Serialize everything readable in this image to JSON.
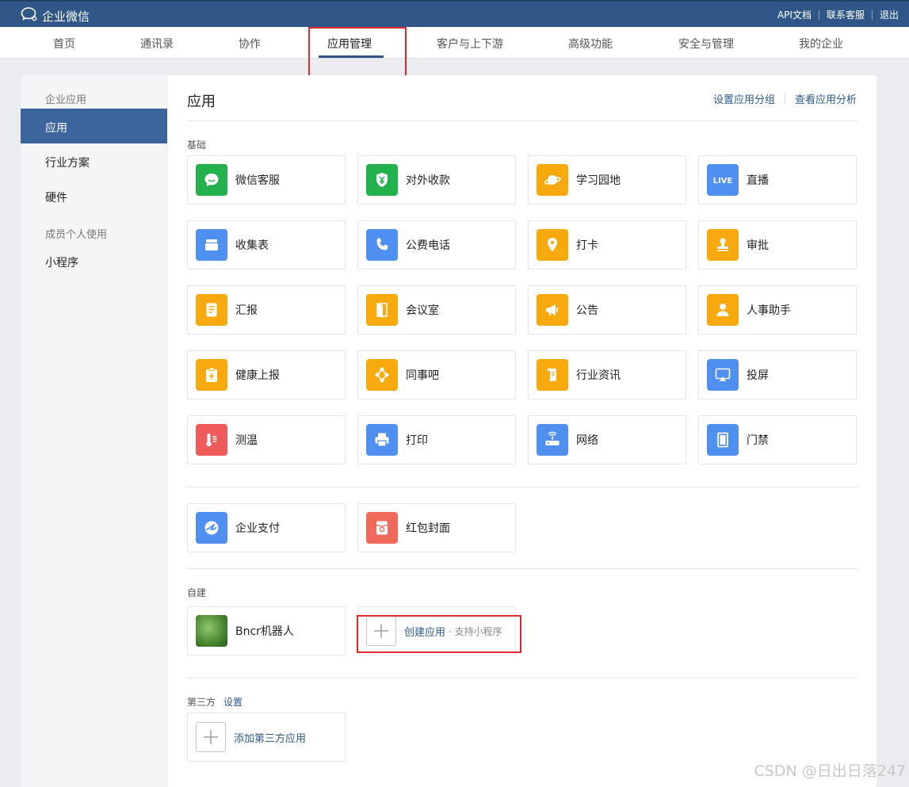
{
  "topbar": {
    "logo_text": "企业微信",
    "links": [
      "API文档",
      "联系客服",
      "退出"
    ]
  },
  "nav": {
    "items": [
      "首页",
      "通讯录",
      "协作",
      "应用管理",
      "客户与上下游",
      "高级功能",
      "安全与管理",
      "我的企业"
    ],
    "active": "应用管理"
  },
  "sidebar": {
    "group1": "企业应用",
    "items1": [
      "应用",
      "行业方案",
      "硬件"
    ],
    "group2": "成员个人使用",
    "items2": [
      "小程序"
    ]
  },
  "main": {
    "title": "应用",
    "actions": [
      "设置应用分组",
      "查看应用分析"
    ],
    "basic_label": "基础",
    "basic_apps": [
      {
        "label": "微信客服",
        "icon": "chat-bubble-icon",
        "color": "#22b14c"
      },
      {
        "label": "对外收款",
        "icon": "yuan-shield-icon",
        "color": "#22b14c"
      },
      {
        "label": "学习园地",
        "icon": "planet-icon",
        "color": "#f7a90e"
      },
      {
        "label": "直播",
        "icon": "live-icon",
        "color": "#4f8fef"
      },
      {
        "label": "收集表",
        "icon": "form-box-icon",
        "color": "#4f8fef"
      },
      {
        "label": "公费电话",
        "icon": "phone-icon",
        "color": "#4f8fef"
      },
      {
        "label": "打卡",
        "icon": "location-pin-icon",
        "color": "#f7a90e"
      },
      {
        "label": "审批",
        "icon": "stamp-icon",
        "color": "#f7a90e"
      },
      {
        "label": "汇报",
        "icon": "report-doc-icon",
        "color": "#f7a90e"
      },
      {
        "label": "会议室",
        "icon": "door-icon",
        "color": "#f7a90e"
      },
      {
        "label": "公告",
        "icon": "megaphone-icon",
        "color": "#f7a90e"
      },
      {
        "label": "人事助手",
        "icon": "person-icon",
        "color": "#f7a90e"
      },
      {
        "label": "健康上报",
        "icon": "clipboard-plus-icon",
        "color": "#f7a90e"
      },
      {
        "label": "同事吧",
        "icon": "network-nodes-icon",
        "color": "#f7a90e"
      },
      {
        "label": "行业资讯",
        "icon": "scroll-icon",
        "color": "#f7a90e"
      },
      {
        "label": "投屏",
        "icon": "screen-cast-icon",
        "color": "#4f8fef"
      },
      {
        "label": "测温",
        "icon": "thermometer-icon",
        "color": "#ef5a5a"
      },
      {
        "label": "打印",
        "icon": "printer-icon",
        "color": "#4f8fef"
      },
      {
        "label": "网络",
        "icon": "router-icon",
        "color": "#4f8fef"
      },
      {
        "label": "门禁",
        "icon": "access-door-icon",
        "color": "#4f8fef"
      }
    ],
    "extra_apps": [
      {
        "label": "企业支付",
        "icon": "pay-swoosh-icon",
        "color": "#4f8fef"
      },
      {
        "label": "红包封面",
        "icon": "red-packet-icon",
        "color": "#ef6a5a"
      }
    ],
    "custom_label": "自建",
    "custom_app": {
      "label": "Bncr机器人",
      "icon": "bot-avatar-icon"
    },
    "create_app": {
      "label": "创建应用",
      "sub": "· 支持小程序"
    },
    "third_label": "第三方",
    "third_setting": "设置",
    "add_third": "添加第三方应用"
  },
  "watermark": "CSDN @日出日落247"
}
